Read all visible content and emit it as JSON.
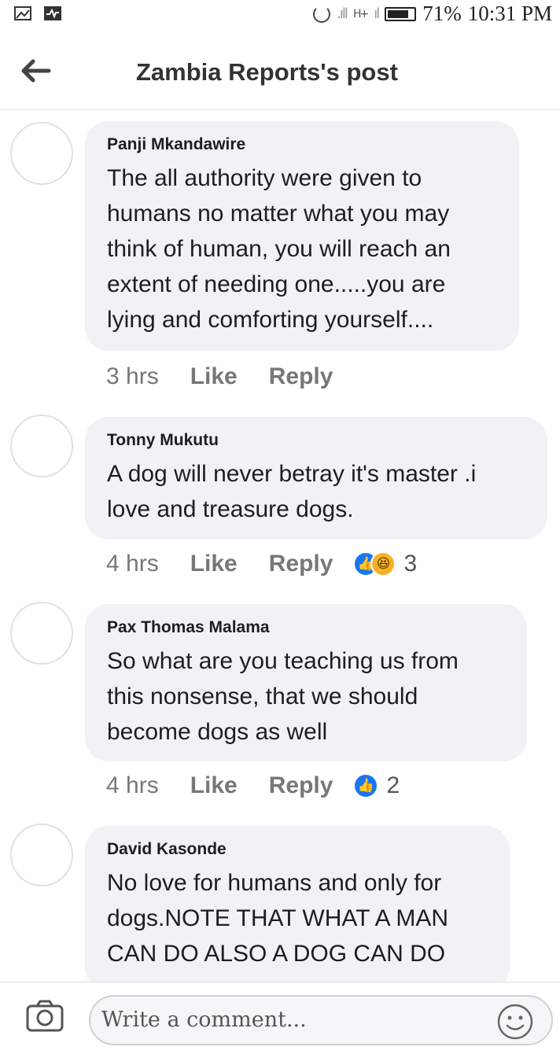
{
  "status_bar": {
    "left_icons": [
      "image-icon",
      "activity-icon"
    ],
    "battery": "71%",
    "time": "10:31 PM",
    "network": "H+"
  },
  "header": {
    "title": "Zambia Reports's post"
  },
  "comments": [
    {
      "author": "Panji Mkandawire",
      "lines": [
        "The all authority were given to",
        "humans no matter what you may",
        "think of human, you will reach an",
        "extent of needing one.....you are",
        "lying and comforting yourself...."
      ],
      "time": "3 hrs",
      "like_label": "Like",
      "reply_label": "Reply"
    },
    {
      "author": "Tonny Mukutu",
      "lines": [
        "A dog will never betray it's master .i",
        "love and treasure dogs."
      ],
      "time": "4 hrs",
      "like_label": "Like",
      "reply_label": "Reply",
      "reaction_count": "3"
    },
    {
      "author": "Pax Thomas Malama",
      "lines": [
        "So what are you teaching us from",
        "this nonsense, that we should",
        "become dogs as well"
      ],
      "time": "4 hrs",
      "like_label": "Like",
      "reply_label": "Reply",
      "reaction_count": "2"
    },
    {
      "author": "David Kasonde",
      "lines": [
        "No love for humans and only for",
        "dogs.NOTE THAT WHAT A MAN",
        "CAN DO ALSO A DOG CAN DO"
      ]
    }
  ],
  "composer": {
    "placeholder": "Write a comment..."
  }
}
